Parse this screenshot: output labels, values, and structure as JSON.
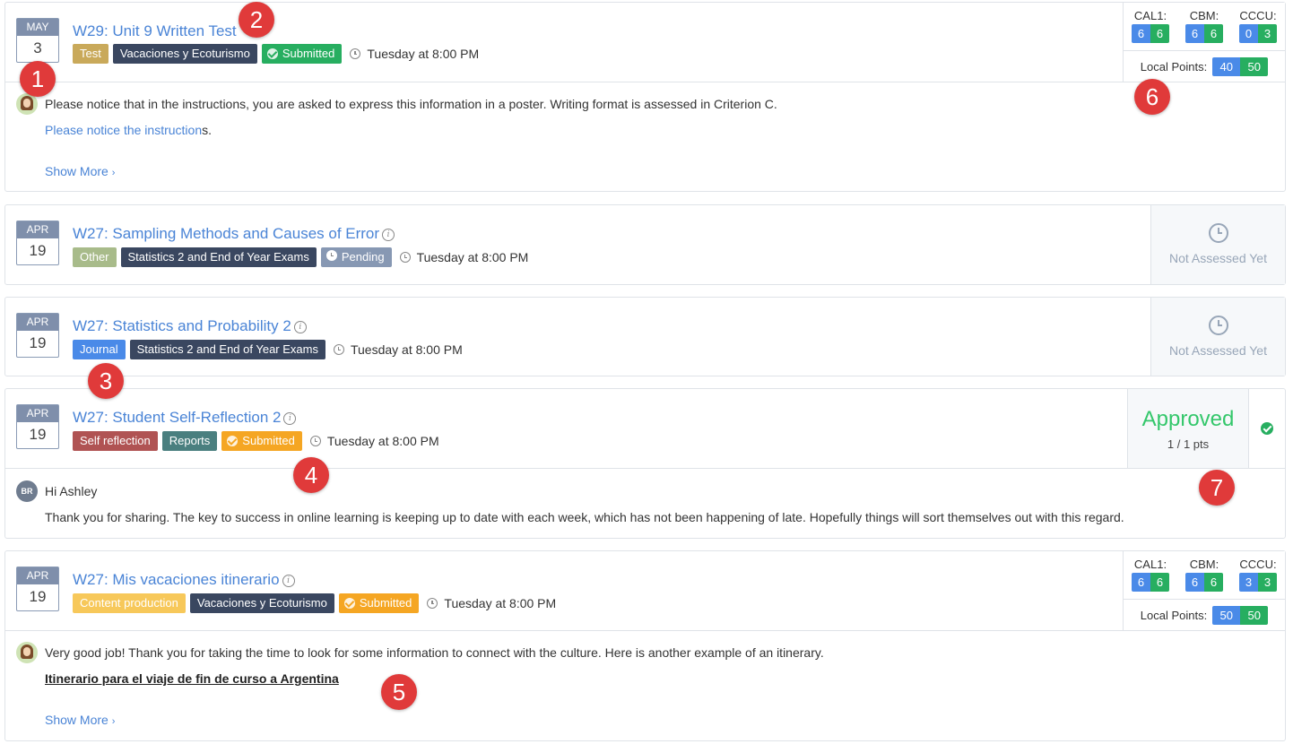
{
  "colors": {
    "link": "#4a84d6",
    "approved": "#34c76b",
    "badge": "#e03a3a"
  },
  "items": [
    {
      "month": "MAY",
      "day": "3",
      "title": "W29: Unit 9 Written Test",
      "tags": [
        {
          "label": "Test",
          "color": "#c9a95a"
        },
        {
          "label": "Vacaciones y Ecoturismo",
          "color": "#3a4760"
        },
        {
          "label": "Submitted",
          "color": "#27ae60",
          "icon": "check-icon"
        }
      ],
      "due": "Tuesday at 8:00 PM",
      "grades": {
        "criteria": [
          {
            "label": "CAL1:",
            "a": "6",
            "b": "6"
          },
          {
            "label": "CBM:",
            "a": "6",
            "b": "6"
          },
          {
            "label": "CCCU:",
            "a": "0",
            "b": "3"
          }
        ],
        "local_label": "Local Points:",
        "local_a": "40",
        "local_b": "50"
      },
      "comment": {
        "text": "Please notice that in the instructions, you are asked to express this information in a poster. Writing format is assessed in Criterion C.",
        "link_part": "Please notice the instruction",
        "link_tail": "s.",
        "show_more": "Show More"
      }
    },
    {
      "month": "APR",
      "day": "19",
      "title": "W27: Sampling Methods and Causes of Error",
      "tags": [
        {
          "label": "Other",
          "color": "#a8bb8a"
        },
        {
          "label": "Statistics 2 and End of Year Exams",
          "color": "#3a4760"
        },
        {
          "label": "Pending",
          "color": "#8798b3",
          "icon": "clock-icon"
        }
      ],
      "due": "Tuesday at 8:00 PM",
      "status": "Not Assessed Yet"
    },
    {
      "month": "APR",
      "day": "19",
      "title": "W27: Statistics and Probability 2",
      "tags": [
        {
          "label": "Journal",
          "color": "#4a8ae8"
        },
        {
          "label": "Statistics 2 and End of Year Exams",
          "color": "#3a4760"
        }
      ],
      "due": "Tuesday at 8:00 PM",
      "status": "Not Assessed Yet"
    },
    {
      "month": "APR",
      "day": "19",
      "title": "W27: Student Self-Reflection 2",
      "tags": [
        {
          "label": "Self reflection",
          "color": "#b05353"
        },
        {
          "label": "Reports",
          "color": "#4a7f7f"
        },
        {
          "label": "Submitted",
          "color": "#f5a623",
          "icon": "check-icon"
        }
      ],
      "due": "Tuesday at 8:00 PM",
      "result": {
        "label": "Approved",
        "points": "1 / 1 pts"
      },
      "comment": {
        "avatar_initials": "BR",
        "greeting": "Hi Ashley",
        "text": "Thank you for sharing. The key to success in online learning is keeping up to date with each week, which has not been happening of late. Hopefully things will sort themselves out with this regard."
      }
    },
    {
      "month": "APR",
      "day": "19",
      "title": "W27: Mis vacaciones itinerario",
      "tags": [
        {
          "label": "Content production",
          "color": "#f7c85a"
        },
        {
          "label": "Vacaciones y Ecoturismo",
          "color": "#3a4760"
        },
        {
          "label": "Submitted",
          "color": "#f5a623",
          "icon": "check-icon"
        }
      ],
      "due": "Tuesday at 8:00 PM",
      "grades": {
        "criteria": [
          {
            "label": "CAL1:",
            "a": "6",
            "b": "6"
          },
          {
            "label": "CBM:",
            "a": "6",
            "b": "6"
          },
          {
            "label": "CCCU:",
            "a": "3",
            "b": "3"
          }
        ],
        "local_label": "Local Points:",
        "local_a": "50",
        "local_b": "50"
      },
      "comment": {
        "text": "Very good job! Thank you for taking the time to look for some information to connect with the culture. Here is another example of an itinerary.",
        "link": "Itinerario para el viaje de fin de curso a Argentina",
        "show_more": "Show More"
      }
    }
  ],
  "callouts": [
    "1",
    "2",
    "3",
    "4",
    "5",
    "6",
    "7"
  ]
}
